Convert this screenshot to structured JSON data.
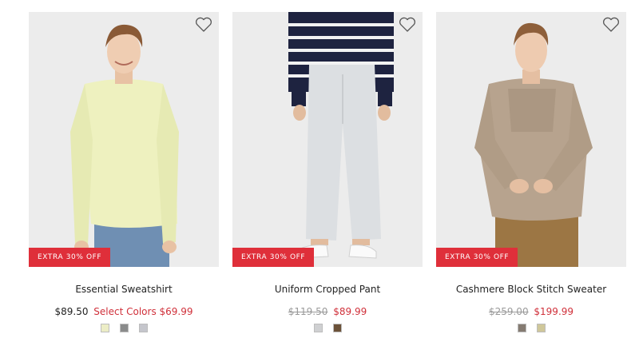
{
  "products": [
    {
      "name": "Essential Sweatshirt",
      "badge": "EXTRA 30% OFF",
      "price_current": "$89.50",
      "price_sale": "Select Colors $69.99",
      "swatches": [
        "#ecedc6",
        "#8a8b8b",
        "#c5c6cc"
      ],
      "wishlist_icon": "heart-outline-icon"
    },
    {
      "name": "Uniform Cropped Pant",
      "badge": "EXTRA 30% OFF",
      "price_original": "$119.50",
      "price_sale": "$89.99",
      "swatches": [
        "#cfd0d2",
        "#6c5239"
      ],
      "wishlist_icon": "heart-outline-icon"
    },
    {
      "name": "Cashmere Block Stitch Sweater",
      "badge": "EXTRA 30% OFF",
      "price_original": "$259.00",
      "price_sale": "$199.99",
      "swatches": [
        "#857b72",
        "#cfc79a"
      ],
      "wishlist_icon": "heart-outline-icon"
    }
  ],
  "colors": {
    "badge_bg": "#df2f3a",
    "sale_price": "#d0303a",
    "strike_price": "#9a9a9a"
  }
}
